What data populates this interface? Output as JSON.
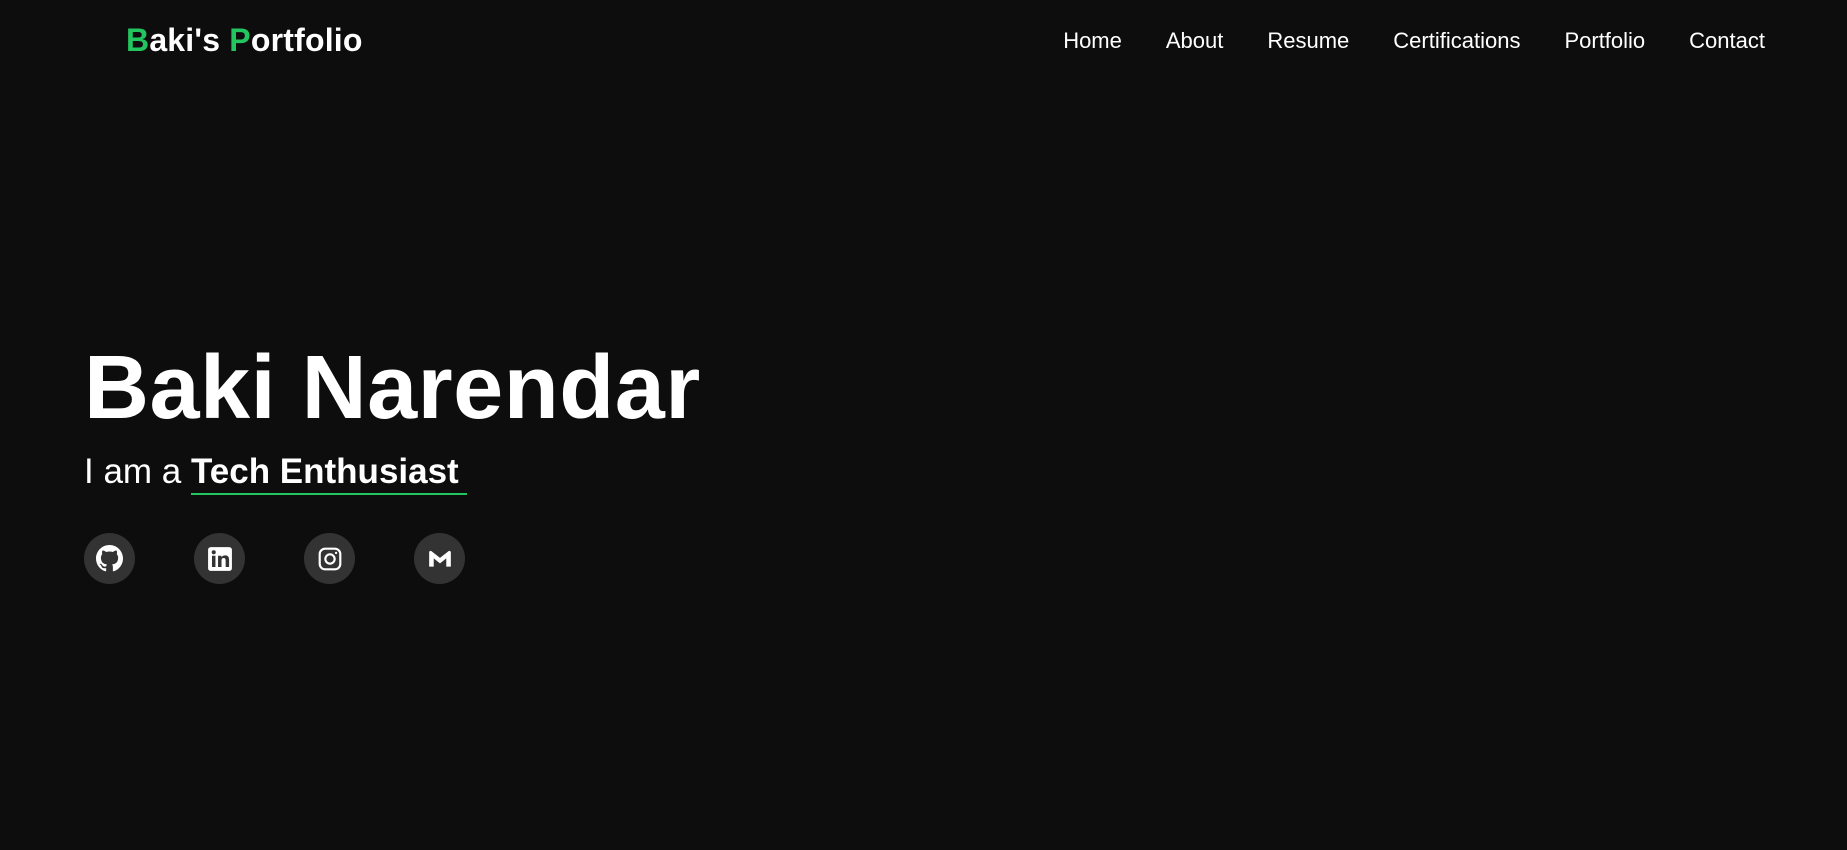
{
  "brand": {
    "first_letter": "B",
    "first_rest": "aki's ",
    "second_letter": "P",
    "second_rest": "ortfolio",
    "accent_color": "#22c55e"
  },
  "nav": {
    "items": [
      {
        "label": "Home"
      },
      {
        "label": "About"
      },
      {
        "label": "Resume"
      },
      {
        "label": "Certifications"
      },
      {
        "label": "Portfolio"
      },
      {
        "label": "Contact"
      }
    ]
  },
  "hero": {
    "name": "Baki Narendar",
    "subtitle_prefix": "I am a ",
    "subtitle_typed": "Tech Enthusiast"
  },
  "socials": [
    {
      "icon": "github-icon"
    },
    {
      "icon": "linkedin-icon"
    },
    {
      "icon": "instagram-icon"
    },
    {
      "icon": "mail-icon"
    }
  ],
  "colors": {
    "background": "#0d0d0d",
    "text": "#ffffff",
    "social_bg": "#333333"
  }
}
